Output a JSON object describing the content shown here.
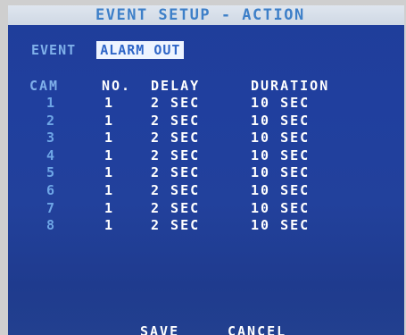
{
  "title": "EVENT SETUP - ACTION",
  "event": {
    "label": "EVENT",
    "value": "ALARM OUT"
  },
  "table": {
    "headers": {
      "cam": "CAM",
      "no": "NO.",
      "delay": "DELAY",
      "duration": "DURATION"
    },
    "rows": [
      {
        "cam": "1",
        "no": "1",
        "delay": "2 SEC",
        "duration": "10 SEC"
      },
      {
        "cam": "2",
        "no": "1",
        "delay": "2 SEC",
        "duration": "10 SEC"
      },
      {
        "cam": "3",
        "no": "1",
        "delay": "2 SEC",
        "duration": "10 SEC"
      },
      {
        "cam": "4",
        "no": "1",
        "delay": "2 SEC",
        "duration": "10 SEC"
      },
      {
        "cam": "5",
        "no": "1",
        "delay": "2 SEC",
        "duration": "10 SEC"
      },
      {
        "cam": "6",
        "no": "1",
        "delay": "2 SEC",
        "duration": "10 SEC"
      },
      {
        "cam": "7",
        "no": "1",
        "delay": "2 SEC",
        "duration": "10 SEC"
      },
      {
        "cam": "8",
        "no": "1",
        "delay": "2 SEC",
        "duration": "10 SEC"
      }
    ]
  },
  "footer": {
    "save_label": "SAVE",
    "cancel_label": "CANCEL"
  },
  "colors": {
    "screen_bg": "#203f9e",
    "title_bg": "#dfe6ef",
    "title_text": "#3d7fc8",
    "label_blue": "#7fb0ea",
    "highlight_bg": "#eef4ff",
    "value_white": "#ffffff"
  }
}
